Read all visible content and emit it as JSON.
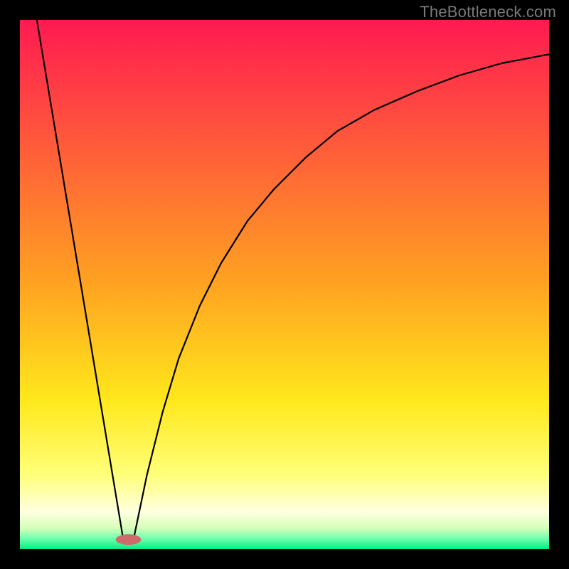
{
  "watermark": "TheBottleneck.com",
  "colors": {
    "frame_border": "#000000",
    "curve": "#000000",
    "oval_fill": "#cf6a6a",
    "gradient_stops": [
      {
        "offset": 0.0,
        "color": "#ff1a51"
      },
      {
        "offset": 0.5,
        "color": "#ffa321"
      },
      {
        "offset": 0.72,
        "color": "#ffe81c"
      },
      {
        "offset": 0.86,
        "color": "#ffff7a"
      },
      {
        "offset": 0.93,
        "color": "#ffffe0"
      },
      {
        "offset": 0.96,
        "color": "#d6ffb8"
      },
      {
        "offset": 0.98,
        "color": "#70ffb0"
      },
      {
        "offset": 1.0,
        "color": "#00ef82"
      }
    ]
  },
  "chart_data": {
    "type": "line",
    "title": "",
    "xlabel": "",
    "ylabel": "",
    "xlim": [
      0,
      100
    ],
    "ylim": [
      0,
      100
    ],
    "grid": false,
    "legend": false,
    "series": [
      {
        "name": "left-descending-segment",
        "x": [
          3.2,
          19.5
        ],
        "values": [
          100,
          2
        ]
      },
      {
        "name": "right-ascending-curve",
        "x": [
          21.5,
          24,
          27,
          30,
          34,
          38,
          43,
          48,
          54,
          60,
          67,
          75,
          83,
          91,
          100
        ],
        "values": [
          2,
          14,
          26,
          36,
          46,
          54,
          62,
          68,
          74,
          79,
          83,
          86.5,
          89.5,
          91.8,
          93.5
        ]
      }
    ],
    "annotations": [
      {
        "type": "oval",
        "cx": 20.5,
        "cy": 1.8,
        "rx": 2.4,
        "ry": 1.0,
        "fill_color": "#cf6a6a"
      }
    ]
  }
}
